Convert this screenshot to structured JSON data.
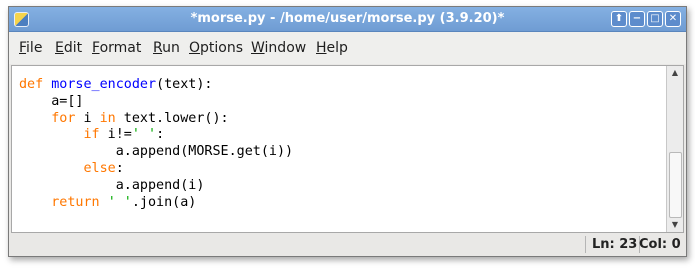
{
  "window": {
    "title": "*morse.py - /home/user/morse.py (3.9.20)*",
    "buttons": {
      "maximize_glyph": "⬆",
      "minimize_glyph": "−",
      "restore_glyph": "□",
      "close_glyph": "✕"
    }
  },
  "menu": {
    "items": [
      "File",
      "Edit",
      "Format",
      "Run",
      "Options",
      "Window",
      "Help"
    ]
  },
  "editor": {
    "lines": [
      {
        "indent": "",
        "tokens": [
          [
            "kw",
            "def "
          ],
          [
            "fn",
            "morse_encoder"
          ],
          [
            "",
            "(text):"
          ]
        ]
      },
      {
        "indent": "    ",
        "tokens": [
          [
            "",
            "a=[]"
          ]
        ]
      },
      {
        "indent": "    ",
        "tokens": [
          [
            "kw",
            "for"
          ],
          [
            "",
            " i "
          ],
          [
            "kw",
            "in"
          ],
          [
            "",
            " text.lower():"
          ]
        ]
      },
      {
        "indent": "        ",
        "tokens": [
          [
            "kw",
            "if"
          ],
          [
            "",
            " i!="
          ],
          [
            "str",
            "' '"
          ],
          [
            "",
            ":"
          ]
        ]
      },
      {
        "indent": "            ",
        "tokens": [
          [
            "",
            "a.append(MORSE.get(i))"
          ]
        ]
      },
      {
        "indent": "        ",
        "tokens": [
          [
            "kw",
            "else"
          ],
          [
            "",
            ":"
          ]
        ]
      },
      {
        "indent": "            ",
        "tokens": [
          [
            "",
            "a.append(i)"
          ]
        ]
      },
      {
        "indent": "    ",
        "tokens": [
          [
            "kw",
            "return"
          ],
          [
            "",
            " "
          ],
          [
            "str",
            "' '"
          ],
          [
            "",
            ".join(a)"
          ]
        ]
      }
    ]
  },
  "status": {
    "line": "Ln: 23",
    "col": "Col: 0"
  },
  "colors": {
    "keyword": "#ff7700",
    "function_name": "#0000ff",
    "string": "#00aa00",
    "titlebar": "#7aa7dc"
  }
}
